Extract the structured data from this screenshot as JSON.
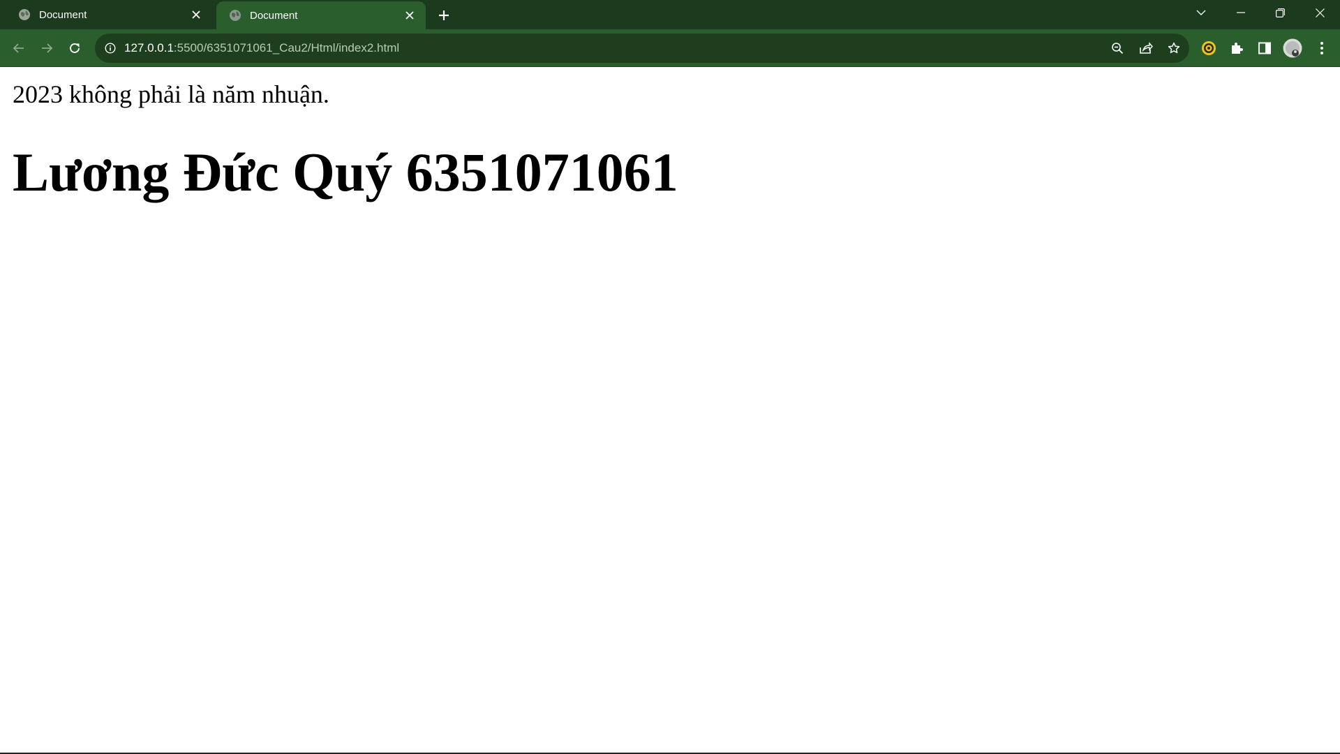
{
  "tabs": [
    {
      "title": "Document",
      "active": false,
      "favicon": "globe-icon"
    },
    {
      "title": "Document",
      "active": true,
      "favicon": "globe-icon"
    }
  ],
  "address_bar": {
    "host": "127.0.0.1",
    "path": ":5500/6351071061_Cau2/Html/index2.html"
  },
  "page": {
    "result_text": "2023 không phải là năm nhuận.",
    "heading": "Lương Đức Quý 6351071061"
  },
  "colors": {
    "tab_strip": "#1c3a1d",
    "toolbar": "#2a5e2c",
    "omnibox": "#1d3f1e",
    "page_background": "#ffffff"
  },
  "icons": {
    "back": "arrow-left-icon",
    "forward": "arrow-right-icon",
    "reload": "reload-icon",
    "site_info": "info-icon",
    "zoom": "zoom-out-icon",
    "share": "share-icon",
    "bookmark": "star-icon",
    "extension": "extension-badge-icon",
    "extensions_menu": "puzzle-icon",
    "side_panel": "side-panel-icon",
    "profile": "avatar-icon",
    "menu": "kebab-menu-icon"
  }
}
